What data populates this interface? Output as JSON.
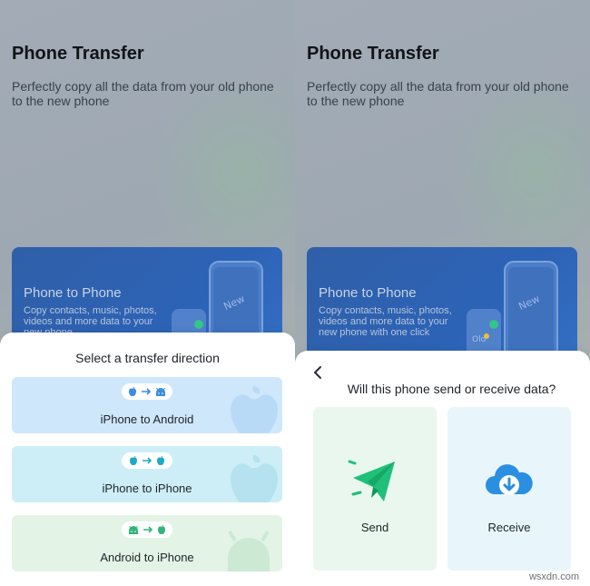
{
  "app": {
    "title": "Phone Transfer",
    "subtitle": "Perfectly copy all the data from your old phone to the new phone"
  },
  "hero": {
    "title": "Phone to Phone",
    "desc_left": "Copy contacts, music, photos, videos and more data to your new phone",
    "desc_right": "Copy contacts, music, photos, videos and more data to your new phone with one click",
    "phone_new_label": "New",
    "phone_old_label": "Old"
  },
  "direction_sheet": {
    "title": "Select a transfer direction",
    "options": [
      {
        "label": "iPhone to Android",
        "from_icon": "apple-icon",
        "to_icon": "android-icon"
      },
      {
        "label": "iPhone to iPhone",
        "from_icon": "apple-icon",
        "to_icon": "apple-icon"
      },
      {
        "label": "Android to iPhone",
        "from_icon": "android-icon",
        "to_icon": "apple-icon"
      }
    ]
  },
  "role_sheet": {
    "title": "Will this phone send or receive data?",
    "send_label": "Send",
    "receive_label": "Receive"
  },
  "watermark": "wsxdn.com",
  "colors": {
    "accent_blue": "#2d63b6",
    "send_green": "#1fc07a",
    "receive_blue": "#2a8fe0",
    "apple_icon": "#3a8fe0",
    "android_icon": "#2fb57a"
  }
}
